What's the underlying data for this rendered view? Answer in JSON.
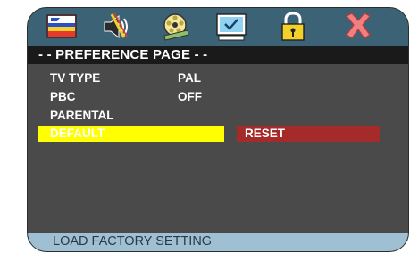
{
  "icons": [
    {
      "name": "language-flag-icon"
    },
    {
      "name": "audio-speaker-icon"
    },
    {
      "name": "video-film-icon"
    },
    {
      "name": "preference-monitor-icon"
    },
    {
      "name": "password-lock-icon"
    },
    {
      "name": "exit-x-icon"
    }
  ],
  "colors": {
    "icon_bar": "#3c6276",
    "body": "#4a4a4a",
    "header": "#1a1a1a",
    "highlight": "#ffff00",
    "reset_button": "#a52a2a",
    "footer": "#9fbfd3"
  },
  "header": {
    "title": "- - PREFERENCE PAGE - -"
  },
  "menu": {
    "items": [
      {
        "label": "TV TYPE",
        "value": "PAL"
      },
      {
        "label": "PBC",
        "value": "OFF"
      },
      {
        "label": "PARENTAL",
        "value": ""
      },
      {
        "label": "DEFAULT",
        "value": ""
      }
    ],
    "selected_index": 3
  },
  "submenu": {
    "reset_label": "RESET"
  },
  "footer": {
    "hint": "LOAD FACTORY SETTING"
  }
}
